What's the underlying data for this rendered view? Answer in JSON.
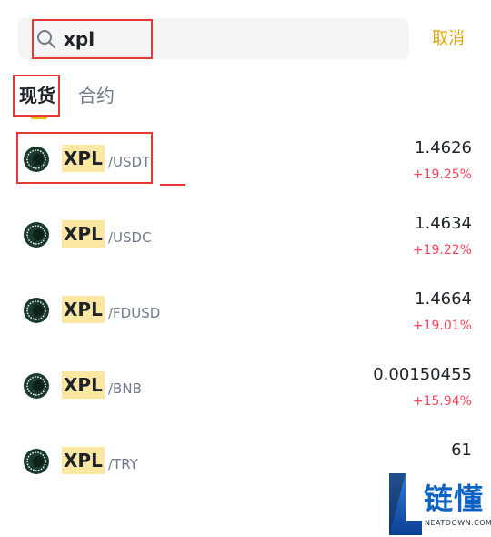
{
  "search": {
    "value": "xpl",
    "cancel_label": "取消"
  },
  "tabs": [
    {
      "label": "现货",
      "active": true
    },
    {
      "label": "合约",
      "active": false
    }
  ],
  "pairs": [
    {
      "base": "XPL",
      "quote": "/USDT",
      "price": "1.4626",
      "change": "+19.25%"
    },
    {
      "base": "XPL",
      "quote": "/USDC",
      "price": "1.4634",
      "change": "+19.22%"
    },
    {
      "base": "XPL",
      "quote": "/FDUSD",
      "price": "1.4664",
      "change": "+19.01%"
    },
    {
      "base": "XPL",
      "quote": "/BNB",
      "price": "0.00150455",
      "change": "+15.94%"
    },
    {
      "base": "XPL",
      "quote": "/TRY",
      "price": "61",
      "change": ""
    }
  ],
  "watermark": {
    "title": "链懂",
    "subtitle": "NEATDOWN.COM"
  },
  "colors": {
    "accent": "#f0b90b",
    "cancel": "#e0a50a",
    "up": "#f6465d",
    "highlight_box": "#e53935",
    "watermark": "#0e62c4"
  }
}
